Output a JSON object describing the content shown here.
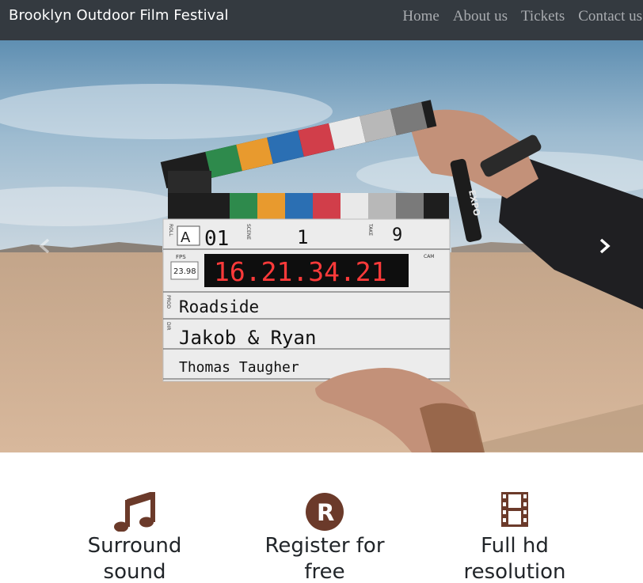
{
  "navbar": {
    "brand": "Brooklyn Outdoor Film Festival",
    "links": [
      "Home",
      "About us",
      "Tickets",
      "Contact us"
    ]
  },
  "hero": {
    "slate": {
      "roll": "A",
      "scene_number": "01",
      "scene": "1",
      "take": "9",
      "fps_label": "FPS",
      "fps": "23.98",
      "timecode": "16.21.34.21",
      "prod": "Roadside",
      "director": "Jakob & Ryan",
      "camera": "Thomas Taugher",
      "labels": {
        "roll": "ROLL",
        "scene": "SCENE",
        "take": "TAKE",
        "cam": "CAM",
        "prod": "PROD",
        "dir": "DIR"
      }
    },
    "marker_text": "EXPO"
  },
  "features": [
    {
      "label": "Surround sound",
      "icon": "music-icon"
    },
    {
      "label": "Register for free",
      "icon": "registered-icon"
    },
    {
      "label": "Full hd resolution",
      "icon": "film-icon"
    }
  ],
  "colors": {
    "navbar_bg": "#343a40",
    "nav_link": "#a9acb0",
    "icon_brown": "#6b3a2a",
    "text_dark": "#212529"
  }
}
